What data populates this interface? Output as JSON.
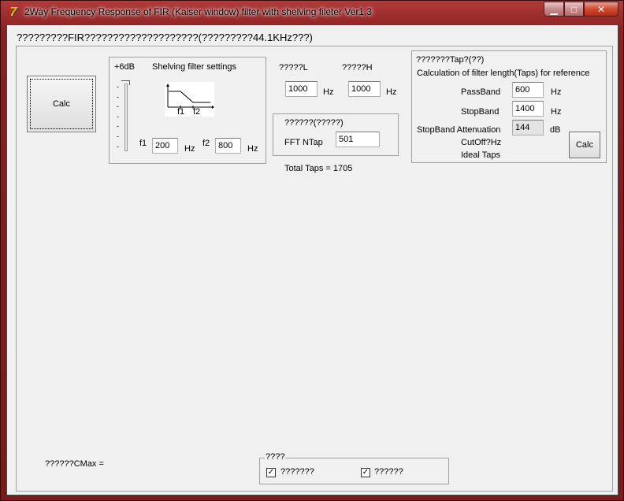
{
  "window": {
    "title": "2Way Frequency Response of FIR (Kaiser window) filter with shelving fileter Ver1.3",
    "app_icon": "7"
  },
  "caption": {
    "min": "▁",
    "max": "□",
    "close": "✕"
  },
  "heading": "?????????FIR????????????????????(?????????44.1KHz???)",
  "calc_button_label": "Calc",
  "shelving": {
    "gain_label": "+6dB",
    "title": "Shelving filter settings",
    "f1_label": "f1",
    "f1_value": "200",
    "f1_unit": "Hz",
    "f2_label": "f2",
    "f2_value": "800",
    "f2_unit": "Hz",
    "diagram_f1": "f1",
    "diagram_f2": "f2",
    "ticks": [
      "-",
      "-",
      "-",
      "-",
      "-",
      "-",
      "-"
    ]
  },
  "crossover": {
    "low_label": "?????L",
    "low_value": "1000",
    "low_unit": "Hz",
    "high_label": "?????H",
    "high_value": "1000",
    "high_unit": "Hz"
  },
  "fft": {
    "group_label": "??????(?????)",
    "ntap_label": "FFT NTap",
    "ntap_value": "501",
    "total_taps": "Total Taps = 1705"
  },
  "taps_calc": {
    "group_label": "???????Tap?(??)",
    "description": "Calculation of filter length(Taps) for reference",
    "passband_label": "PassBand",
    "passband_value": "600",
    "passband_unit": "Hz",
    "stopband_label": "StopBand",
    "stopband_value": "1400",
    "stopband_unit": "Hz",
    "atten_label": "StopBand Attenuation",
    "atten_value": "144",
    "atten_unit": "dB",
    "cutoff_label": "CutOff?Hz",
    "ideal_label": "Ideal Taps",
    "calc_label": "Calc"
  },
  "cmax_label": "??????CMax =",
  "options": {
    "group_label": "????",
    "opt1_label": "???????",
    "opt1_checked": true,
    "opt2_label": "??????",
    "opt2_checked": true,
    "check_glyph": "✓"
  }
}
